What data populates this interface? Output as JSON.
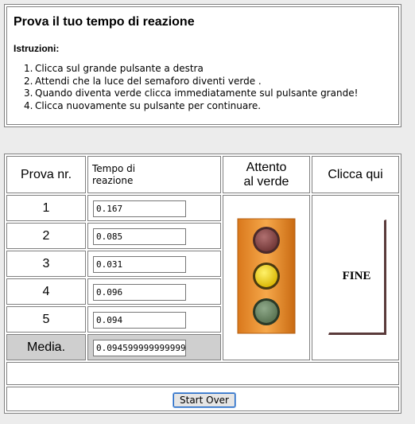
{
  "header": {
    "title": "Prova il tuo tempo di reazione",
    "instructions_label": "Istruzioni:",
    "instructions": [
      {
        "num": "1.",
        "text": "Clicca sul grande pulsante a destra"
      },
      {
        "num": "2.",
        "text": "Attendi che la luce del semaforo diventi verde ."
      },
      {
        "num": "3.",
        "text": "Quando diventa verde clicca immediatamente sul pulsante grande!"
      },
      {
        "num": "4.",
        "text": "Clicca nuovamente su pulsante per continuare."
      }
    ]
  },
  "table": {
    "col_trial": "Prova nr.",
    "col_time_line1": "Tempo di",
    "col_time_line2": "reazione",
    "col_watch_line1": "Attento",
    "col_watch_line2": "al verde",
    "col_click": "Clicca qui",
    "rows": [
      {
        "label": "1",
        "value": "0.167"
      },
      {
        "label": "2",
        "value": "0.085"
      },
      {
        "label": "3",
        "value": "0.031"
      },
      {
        "label": "4",
        "value": "0.096"
      },
      {
        "label": "5",
        "value": "0.094"
      }
    ],
    "average_label": "Media.",
    "average_value": "0.094599999999999"
  },
  "traffic_light": {
    "body_color": "#f29a2e",
    "red_lamp": "#8a4a4a",
    "yellow_lamp": "#f2d21a",
    "green_lamp": "#6f8a6a",
    "active": "yellow"
  },
  "fine_button": {
    "label": "FINE"
  },
  "start_over_button": {
    "label": "Start Over"
  }
}
